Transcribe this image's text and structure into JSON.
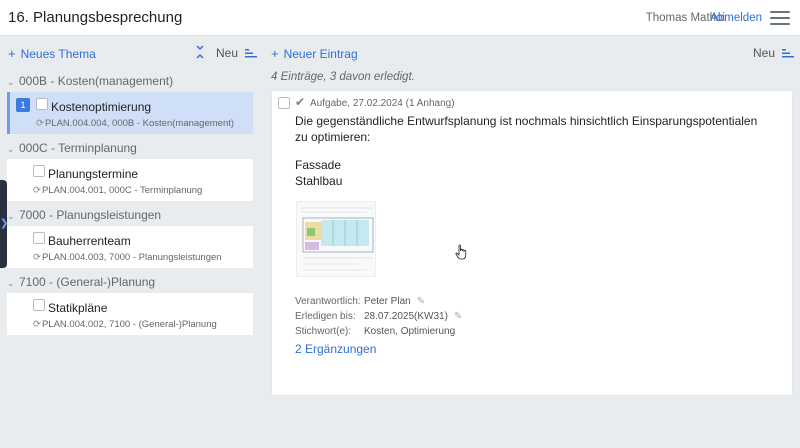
{
  "header": {
    "title": "16. Planungsbesprechung",
    "user": "Thomas Mathoi",
    "logout": "Abmelden",
    "menu_icon": "hamburger-icon"
  },
  "left": {
    "new_topic": "Neues Thema",
    "sort": "Neu",
    "groups": [
      {
        "label": "000B - Kosten(management)",
        "items": [
          {
            "badge": "1",
            "name": "Kostenoptimierung",
            "ref": "PLAN.004.004, 000B - Kosten(management)",
            "selected": true
          }
        ]
      },
      {
        "label": "000C - Terminplanung",
        "items": [
          {
            "name": "Planungstermine",
            "ref": "PLAN.004.001, 000C - Terminplanung"
          }
        ]
      },
      {
        "label": "7000 - Planungsleistungen",
        "items": [
          {
            "name": "Bauherrenteam",
            "ref": "PLAN.004.003, 7000 - Planungsleistungen"
          }
        ]
      },
      {
        "label": "7100 - (General-)Planung",
        "items": [
          {
            "name": "Statikpläne",
            "ref": "PLAN.004.002, 7100 - (General-)Planung"
          }
        ]
      }
    ]
  },
  "right": {
    "new_entry": "Neuer Eintrag",
    "sort": "Neu",
    "summary": "4 Einträge, 3 davon erledigt.",
    "entry": {
      "meta": "Aufgabe, 27.02.2024 (1 Anhang)",
      "text1": "Die gegenständliche Entwurfsplanung ist nochmals hinsichtlich Einsparungspotentialen zu optimieren:",
      "text2": "Fassade",
      "text3": "Stahlbau",
      "fields": {
        "responsible_label": "Verantwortlich:",
        "responsible": "Peter Plan",
        "due_label": "Erledigen bis:",
        "due": "28.07.2025(KW31)",
        "keywords_label": "Stichwort(e):",
        "keywords": "Kosten, Optimierung"
      },
      "more": "2 Ergänzungen"
    }
  },
  "colors": {
    "accent": "#2f6fd6",
    "selected_bg": "#cfdff7",
    "background": "#e9ecef"
  }
}
